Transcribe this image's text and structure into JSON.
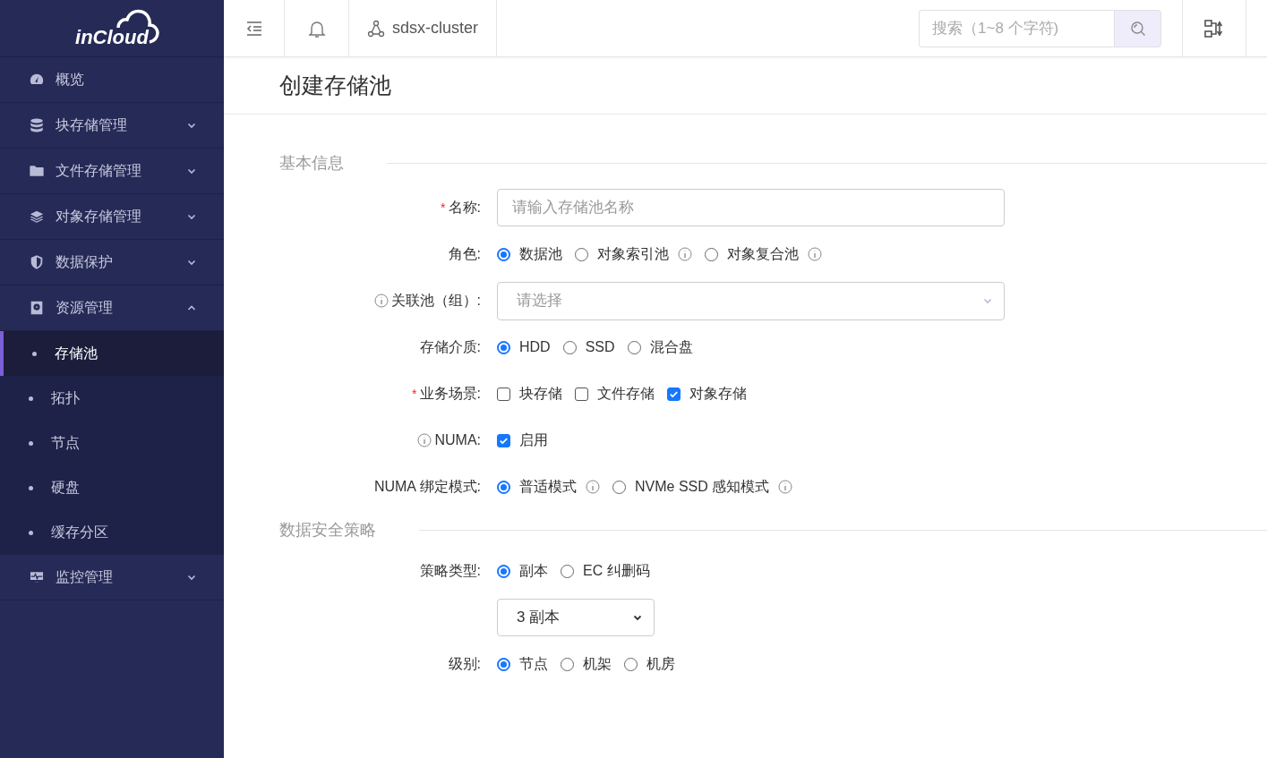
{
  "logo": "inCloud",
  "sidebar": [
    {
      "label": "概览"
    },
    {
      "label": "块存储管理",
      "expanded": false
    },
    {
      "label": "文件存储管理",
      "expanded": false
    },
    {
      "label": "对象存储管理",
      "expanded": false
    },
    {
      "label": "数据保护",
      "expanded": false
    },
    {
      "label": "资源管理",
      "expanded": true,
      "children": [
        {
          "label": "存储池",
          "selected": true
        },
        {
          "label": "拓扑",
          "selected": false
        },
        {
          "label": "节点",
          "selected": false
        },
        {
          "label": "硬盘",
          "selected": false
        },
        {
          "label": "缓存分区",
          "selected": false
        }
      ]
    },
    {
      "label": "监控管理",
      "expanded": false
    }
  ],
  "header": {
    "cluster": "sdsx-cluster",
    "search": {
      "placeholder": "搜索（1~8 个字符)"
    }
  },
  "page_title": "创建存储池",
  "sections": [
    {
      "title": "基本信息",
      "fields": [
        {
          "kind": "text",
          "label": "名称:",
          "required": "*",
          "info": false,
          "placeholder": "请输入存储池名称"
        },
        {
          "kind": "radio",
          "label": "角色:",
          "info": false,
          "options": [
            {
              "label": "数据池",
              "selected": true,
              "info": false
            },
            {
              "label": "对象索引池",
              "selected": false,
              "info": true
            },
            {
              "label": "对象复合池",
              "selected": false,
              "info": true
            }
          ]
        },
        {
          "kind": "select",
          "label": "关联池（组）:",
          "info": true,
          "placeholder": "请选择"
        },
        {
          "kind": "radio",
          "label": "存储介质:",
          "info": false,
          "options": [
            {
              "label": "HDD",
              "selected": true,
              "info": false
            },
            {
              "label": "SSD",
              "selected": false,
              "info": false
            },
            {
              "label": "混合盘",
              "selected": false,
              "info": false
            }
          ]
        },
        {
          "kind": "checkbox",
          "label": "业务场景:",
          "required": "*",
          "info": false,
          "options": [
            {
              "label": "块存储",
              "checked": false
            },
            {
              "label": "文件存储",
              "checked": false
            },
            {
              "label": "对象存储",
              "checked": true
            }
          ]
        },
        {
          "kind": "checkbox",
          "label": "NUMA:",
          "info": true,
          "options": [
            {
              "label": "启用",
              "checked": true
            }
          ]
        },
        {
          "kind": "radio",
          "label": "NUMA 绑定模式:",
          "info": false,
          "options": [
            {
              "label": "普适模式",
              "selected": true,
              "info": true
            },
            {
              "label": "NVMe SSD 感知模式",
              "selected": false,
              "info": true
            }
          ]
        }
      ]
    },
    {
      "title": "数据安全策略",
      "fields": [
        {
          "kind": "radio",
          "label": "策略类型:",
          "info": false,
          "options": [
            {
              "label": "副本",
              "selected": true,
              "info": false
            },
            {
              "label": "EC 纠删码",
              "selected": false,
              "info": false
            }
          ]
        },
        {
          "kind": "dropdown",
          "value": "3 副本"
        },
        {
          "kind": "radio",
          "label": "级别:",
          "info": false,
          "options": [
            {
              "label": "节点",
              "selected": true,
              "info": false
            },
            {
              "label": "机架",
              "selected": false,
              "info": false
            },
            {
              "label": "机房",
              "selected": false,
              "info": false
            }
          ]
        }
      ]
    }
  ]
}
